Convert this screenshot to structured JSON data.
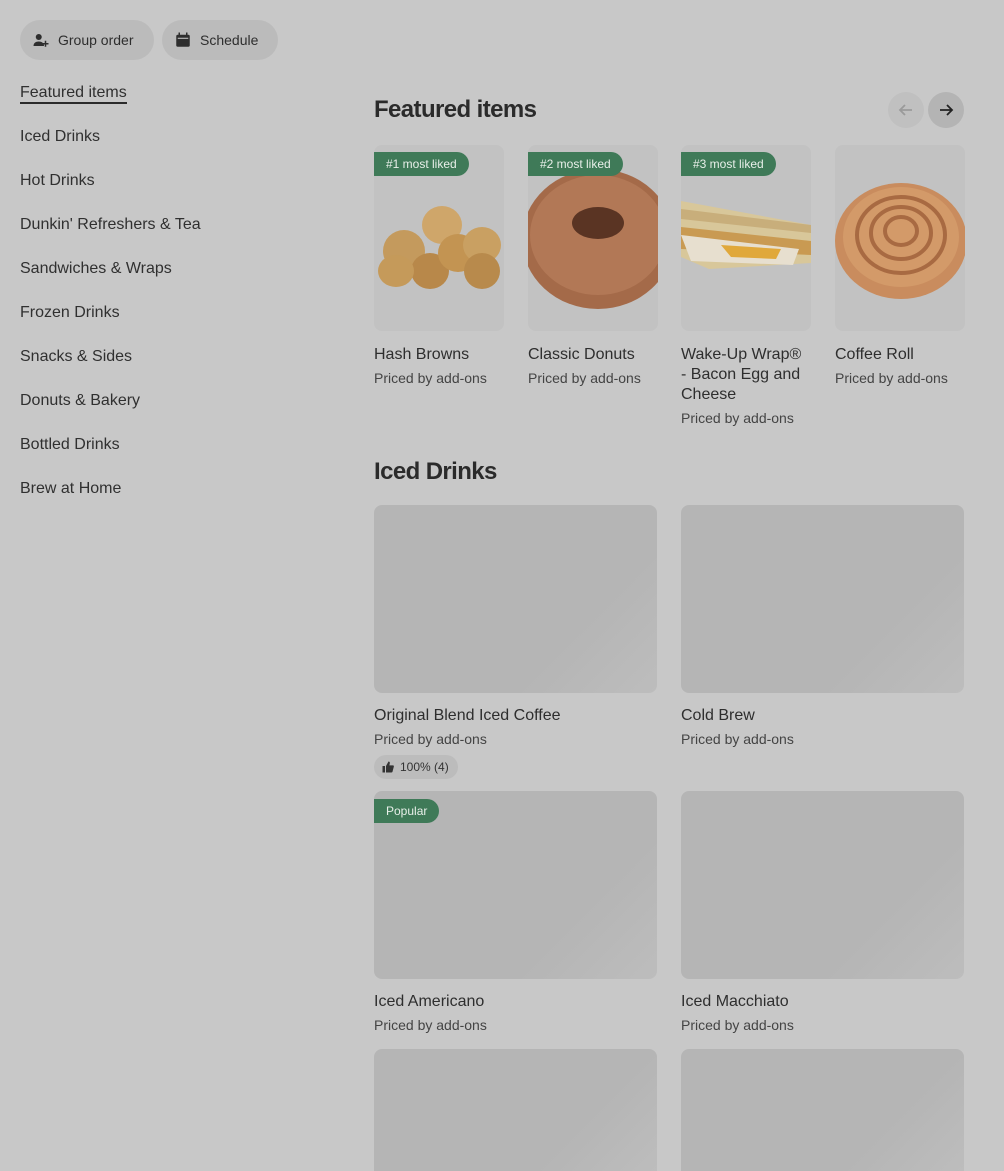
{
  "top_actions": {
    "group_order": "Group order",
    "schedule": "Schedule"
  },
  "sidebar": {
    "items": [
      {
        "label": "Featured items",
        "active": true
      },
      {
        "label": "Iced Drinks"
      },
      {
        "label": "Hot Drinks"
      },
      {
        "label": "Dunkin' Refreshers & Tea"
      },
      {
        "label": "Sandwiches & Wraps"
      },
      {
        "label": "Frozen Drinks"
      },
      {
        "label": "Snacks & Sides"
      },
      {
        "label": "Donuts & Bakery"
      },
      {
        "label": "Bottled Drinks"
      },
      {
        "label": "Brew at Home"
      }
    ]
  },
  "featured": {
    "title": "Featured items",
    "items": [
      {
        "badge": "#1 most liked",
        "name": "Hash Browns",
        "price": "Priced by add-ons"
      },
      {
        "badge": "#2 most liked",
        "name": "Classic Donuts",
        "price": "Priced by add-ons"
      },
      {
        "badge": "#3 most liked",
        "name": "Wake-Up Wrap® - Bacon Egg and Cheese",
        "price": "Priced by add-ons"
      },
      {
        "badge": "",
        "name": "Coffee Roll",
        "price": "Priced by add-ons"
      }
    ]
  },
  "iced": {
    "title": "Iced Drinks",
    "items": [
      {
        "name": "Original Blend Iced Coffee",
        "price": "Priced by add-ons",
        "rating": "100% (4)",
        "badge": ""
      },
      {
        "name": "Cold Brew",
        "price": "Priced by add-ons",
        "badge": ""
      },
      {
        "name": "Iced Americano",
        "price": "Priced by add-ons",
        "badge": "Popular"
      },
      {
        "name": "Iced Macchiato",
        "price": "Priced by add-ons",
        "badge": ""
      }
    ]
  },
  "colors": {
    "badge_green": "#3f7a58",
    "page_bg": "#c8c8c8"
  }
}
